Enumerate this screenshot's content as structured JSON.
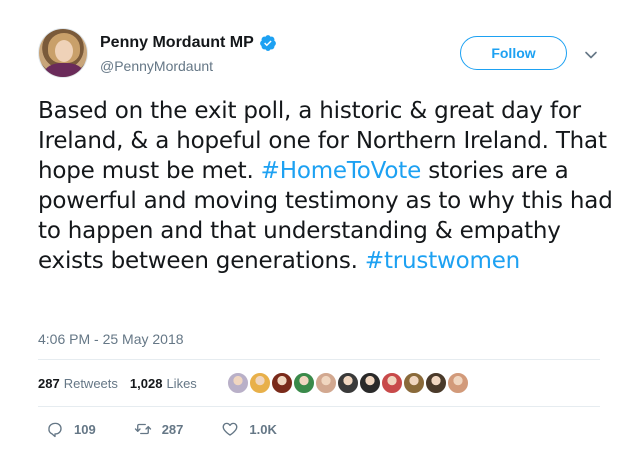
{
  "tweet": {
    "author": {
      "display_name": "Penny Mordaunt MP",
      "handle": "@PennyMordaunt",
      "verified": true
    },
    "follow_label": "Follow",
    "text_segments": [
      {
        "text": "Based on the exit poll, a historic & great day for Ireland, & a hopeful one for Northern Ireland. That hope must be met. ",
        "type": "plain"
      },
      {
        "text": "#HomeToVote",
        "type": "hashtag"
      },
      {
        "text": " stories are a powerful and moving testimony as to why this had to happen and that understanding & empathy exists between generations. ",
        "type": "plain"
      },
      {
        "text": "#trustwomen",
        "type": "hashtag"
      }
    ],
    "timestamp": "4:06 PM - 25 May 2018",
    "stats": {
      "retweets_count": "287",
      "retweets_label": "Retweets",
      "likes_count": "1,028",
      "likes_label": "Likes"
    },
    "likers": [
      {
        "color": "#b9b0c8"
      },
      {
        "color": "#e8b04a"
      },
      {
        "color": "#7a2a1a"
      },
      {
        "color": "#3a8a4a"
      },
      {
        "color": "#d2a890"
      },
      {
        "color": "#3a3a3a"
      },
      {
        "color": "#2a2a2a"
      },
      {
        "color": "#c84a4a"
      },
      {
        "color": "#8a6a3a"
      },
      {
        "color": "#4a3a2a"
      },
      {
        "color": "#d29a7a"
      }
    ],
    "actions": {
      "reply_count": "109",
      "retweet_count": "287",
      "like_count": "1.0K"
    }
  },
  "colors": {
    "accent": "#1da1f2",
    "text": "#14171a",
    "muted": "#657786",
    "divider": "#e6ecf0",
    "verified": "#1da1f2"
  },
  "icons": {
    "verified": "verified-badge-icon",
    "caret": "chevron-down-icon",
    "reply": "reply-icon",
    "retweet": "retweet-icon",
    "like": "heart-icon"
  }
}
